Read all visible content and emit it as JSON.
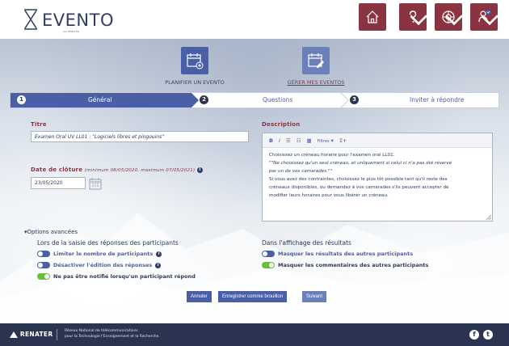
{
  "header": {
    "logo_text": "EVENTO",
    "logo_sub": "par RENATER",
    "icons": [
      "home-icon",
      "help-icon",
      "settings-icon",
      "user-icon"
    ],
    "accent": "#8b3441"
  },
  "actions": {
    "plan_label": "PLANIFIER UN EVENTO",
    "manage_label": "GÉRER MES EVENTOS"
  },
  "stepper": {
    "steps": [
      {
        "num": "1",
        "label": "Général"
      },
      {
        "num": "2",
        "label": "Questions"
      },
      {
        "num": "3",
        "label": "Inviter à répondre"
      }
    ]
  },
  "form": {
    "title_label": "Titre",
    "title_value": "Examen Oral UV LL01 : \"Logiciels libres et pingouins\"",
    "closing_label": "Date de clôture",
    "closing_hint": "(minimum 08/05/2020, maximum 07/05/2021)",
    "closing_value": "23/05/2020",
    "description_label": "Description",
    "toolbar_filters": "Filtres",
    "description_lines": [
      "Choisissez un créneau horaire pour l'examen oral LL01.",
      "\"\"Ne choisissez qu'un seul créneau, et uniquement si celui ci n'a pas été réservé",
      "par un de vos camarades.\"\"",
      "Si vous avez des contraintes, choisissez le plus tôt possible tant qu'il reste des",
      "créneaux disponibles, ou demandez à vos camarades s'ils peuvent accepter de",
      "modifier leurs horaires pour vous libérer un créneau."
    ]
  },
  "advanced": {
    "toggle_label": "Options avancées",
    "group_left_title": "Lors de la saisie des réponses des participants",
    "group_right_title": "Dans l'affichage des résultats",
    "left_options": [
      {
        "label": "Limiter le nombre de participants",
        "on": false
      },
      {
        "label": "Désactiver l'édition des réponses",
        "on": false
      },
      {
        "label": "Ne pas être notifié lorsqu'un participant répond",
        "on": true
      }
    ],
    "right_options": [
      {
        "label": "Masquer les résultats des autres participants",
        "on": false
      },
      {
        "label": "Masquer les commentaires des autres participants",
        "on": true
      }
    ]
  },
  "buttons": {
    "cancel": "Annuler",
    "save_draft": "Enregistrer comme brouillon",
    "next": "Suivant"
  },
  "footer": {
    "brand": "RENATER",
    "line1": "Réseau National de télécommunications",
    "line2": "pour la Technologie l'Enseignement et la Recherche.",
    "social": [
      "f",
      "t"
    ]
  }
}
